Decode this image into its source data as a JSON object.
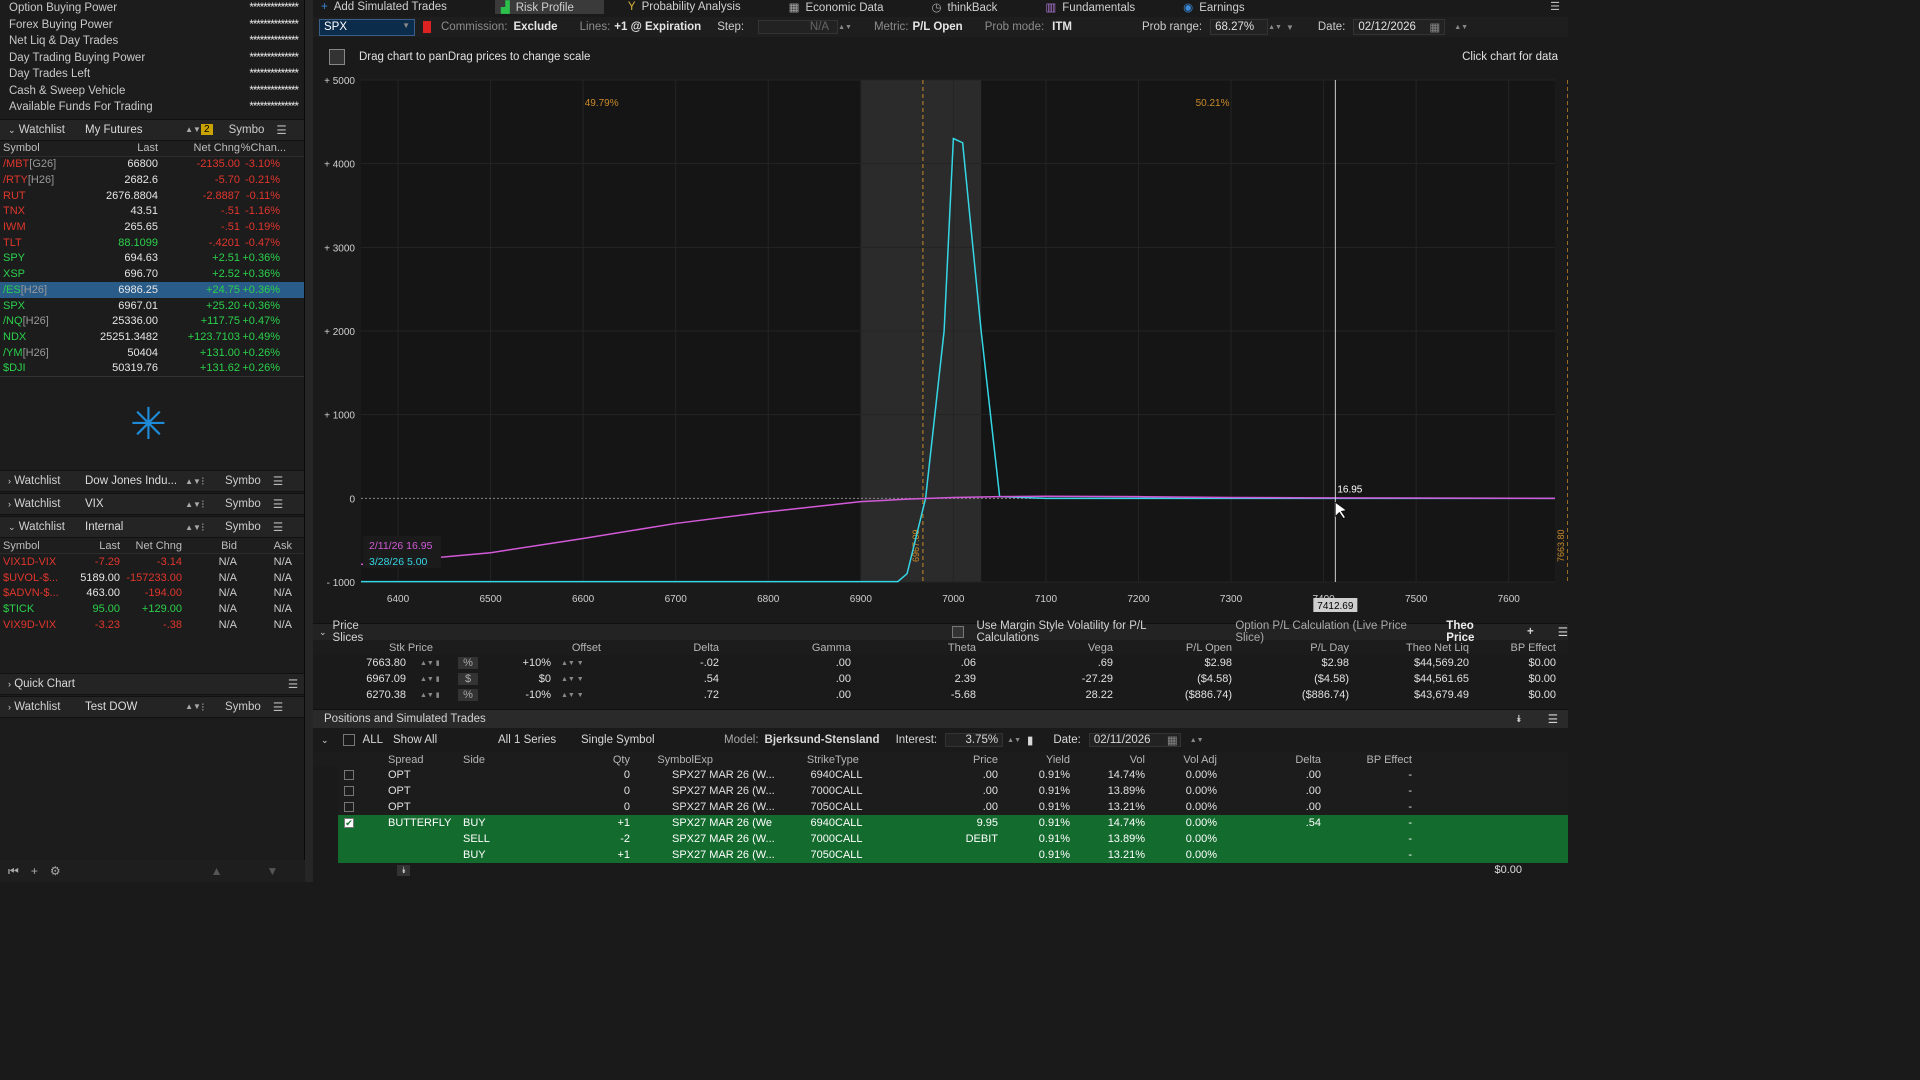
{
  "account": [
    {
      "label": "Option Buying Power",
      "value": "**************"
    },
    {
      "label": "Forex Buying Power",
      "value": "**************"
    },
    {
      "label": "Net Liq & Day Trades",
      "value": "**************"
    },
    {
      "label": "Day Trading Buying Power",
      "value": "**************"
    },
    {
      "label": "Day Trades Left",
      "value": "**************"
    },
    {
      "label": "Cash & Sweep Vehicle",
      "value": "**************"
    },
    {
      "label": "Available Funds For Trading",
      "value": "**************"
    }
  ],
  "wl1": {
    "label": "Watchlist",
    "name": "My Futures",
    "badge": "2",
    "sym": "Symbo",
    "cols": [
      "Symbol",
      "Last",
      "Net Chng",
      "%Chan..."
    ],
    "rows": [
      {
        "sym": "/MBT",
        "sub": "[G26]",
        "last": "66800",
        "net": "-2135.00",
        "pct": "-3.10%",
        "c": "red"
      },
      {
        "sym": "/RTY",
        "sub": "[H26]",
        "last": "2682.6",
        "net": "-5.70",
        "pct": "-0.21%",
        "c": "red"
      },
      {
        "sym": "RUT",
        "sub": "",
        "last": "2676.8804",
        "net": "-2.8887",
        "pct": "-0.11%",
        "c": "red"
      },
      {
        "sym": "TNX",
        "sub": "",
        "last": "43.51",
        "net": "-.51",
        "pct": "-1.16%",
        "c": "red"
      },
      {
        "sym": "IWM",
        "sub": "",
        "last": "265.65",
        "net": "-.51",
        "pct": "-0.19%",
        "c": "red"
      },
      {
        "sym": "TLT",
        "sub": "",
        "last": "88.1099",
        "net": "-.4201",
        "pct": "-0.47%",
        "c": "red"
      },
      {
        "sym": "SPY",
        "sub": "",
        "last": "694.63",
        "net": "+2.51",
        "pct": "+0.36%",
        "c": "grn"
      },
      {
        "sym": "XSP",
        "sub": "",
        "last": "696.70",
        "net": "+2.52",
        "pct": "+0.36%",
        "c": "grn"
      },
      {
        "sym": "/ES",
        "sub": "[H26]",
        "last": "6986.25",
        "net": "+24.75",
        "pct": "+0.36%",
        "c": "grn"
      },
      {
        "sym": "SPX",
        "sub": "",
        "last": "6967.01",
        "net": "+25.20",
        "pct": "+0.36%",
        "c": "grn"
      },
      {
        "sym": "/NQ",
        "sub": "[H26]",
        "last": "25336.00",
        "net": "+117.75",
        "pct": "+0.47%",
        "c": "grn"
      },
      {
        "sym": "NDX",
        "sub": "",
        "last": "25251.3482",
        "net": "+123.7103",
        "pct": "+0.49%",
        "c": "grn"
      },
      {
        "sym": "/YM",
        "sub": "[H26]",
        "last": "50404",
        "net": "+131.00",
        "pct": "+0.26%",
        "c": "grn"
      },
      {
        "sym": "$DJI",
        "sub": "",
        "last": "50319.76",
        "net": "+131.62",
        "pct": "+0.26%",
        "c": "grn"
      }
    ]
  },
  "wl2": {
    "label": "Watchlist",
    "name": "Dow Jones Indu...",
    "sym": "Symbo"
  },
  "wl3": {
    "label": "Watchlist",
    "name": "VIX",
    "sym": "Symbo"
  },
  "wl4": {
    "label": "Watchlist",
    "name": "Internal",
    "sym": "Symbo",
    "cols": [
      "Symbol",
      "Last",
      "Net Chng",
      "Bid",
      "Ask"
    ],
    "rows": [
      {
        "sym": "VIX1D-VIX",
        "last": "-7.29",
        "net": "-3.14",
        "bid": "N/A",
        "ask": "N/A"
      },
      {
        "sym": "$UVOL-$...",
        "last": "5189.00",
        "net": "-157233.00",
        "bid": "N/A",
        "ask": "N/A"
      },
      {
        "sym": "$ADVN-$...",
        "last": "463.00",
        "net": "-194.00",
        "bid": "N/A",
        "ask": "N/A"
      },
      {
        "sym": "$TICK",
        "last": "95.00",
        "net": "+129.00",
        "bid": "N/A",
        "ask": "N/A"
      },
      {
        "sym": "VIX9D-VIX",
        "last": "-3.23",
        "net": "-.38",
        "bid": "N/A",
        "ask": "N/A"
      }
    ]
  },
  "quickchart": "Quick Chart",
  "wl5": {
    "label": "Watchlist",
    "name": "Test DOW",
    "sym": "Symbo"
  },
  "tabs": [
    "Add Simulated Trades",
    "Risk Profile",
    "Probability Analysis",
    "Economic Data",
    "thinkBack",
    "Fundamentals",
    "Earnings"
  ],
  "controls": {
    "symbol": "SPX",
    "commission_lbl": "Commission:",
    "commission": "Exclude",
    "lines_lbl": "Lines:",
    "lines": "+1 @ Expiration",
    "step_lbl": "Step:",
    "step": "N/A",
    "metric_lbl": "Metric:",
    "metric": "P/L Open",
    "probmode_lbl": "Prob mode:",
    "probmode": "ITM",
    "probrange_lbl": "Prob range:",
    "probrange": "68.27%",
    "date_lbl": "Date:",
    "date": "02/12/2026"
  },
  "chart_hint": "Drag chart to panDrag prices to change scale",
  "chart_click": "Click chart for data",
  "chart_data": {
    "type": "line",
    "xlabel": "",
    "ylabel": "",
    "xlim": [
      6360,
      7650
    ],
    "ylim": [
      -1000,
      5000
    ],
    "xticks": [
      "6400",
      "6500",
      "6600",
      "6700",
      "6800",
      "6900",
      "7000",
      "7100",
      "7200",
      "7300",
      "7400",
      "7500",
      "7600"
    ],
    "yticks": [
      "+ 5000",
      "+ 4000",
      "+ 3000",
      "+ 2000",
      "+ 1000",
      "0",
      "- 1000"
    ],
    "series": [
      {
        "name": "3/28/26 5.00",
        "color": "#35d7e6",
        "x": [
          6360,
          6900,
          6940,
          6950,
          6970,
          6990,
          7000,
          7010,
          7030,
          7050,
          7100,
          7200,
          7650
        ],
        "y": [
          -995,
          -995,
          -995,
          -900,
          0,
          2000,
          4300,
          4250,
          2000,
          20,
          0,
          0,
          0
        ]
      },
      {
        "name": "2/11/26 16.95",
        "color": "#d25ad8",
        "x": [
          6360,
          6500,
          6600,
          6700,
          6800,
          6900,
          6950,
          7000,
          7050,
          7100,
          7200,
          7300,
          7400,
          7650
        ],
        "y": [
          -790,
          -650,
          -480,
          -300,
          -160,
          -40,
          -10,
          10,
          20,
          25,
          20,
          10,
          5,
          0
        ]
      }
    ],
    "pct_left": "49.79%",
    "pct_right": "50.21%",
    "vline_left": "6967.09",
    "vline_right": "7663.80",
    "cursor_x": "7412.69",
    "cursor_val": "16.95"
  },
  "price_slices": {
    "title": "Price Slices",
    "margin_lbl": "Use Margin Style Volatility for P/L Calculations",
    "calc_lbl": "Option P/L Calculation (Live Price Slice)",
    "calc": "Theo Price",
    "cols": [
      "Stk Price",
      "Offset",
      "Delta",
      "Gamma",
      "Theta",
      "Vega",
      "P/L Open",
      "P/L Day",
      "Theo Net Liq",
      "BP Effect"
    ],
    "rows": [
      {
        "stk": "7663.80",
        "unit": "%",
        "off": "+10%",
        "delta": "-.02",
        "gamma": ".00",
        "theta": ".06",
        "vega": ".69",
        "plopen": "$2.98",
        "plday": "$2.98",
        "liq": "$44,569.20",
        "bp": "$0.00"
      },
      {
        "stk": "6967.09",
        "unit": "$",
        "off": "$0",
        "delta": ".54",
        "gamma": ".00",
        "theta": "2.39",
        "vega": "-27.29",
        "plopen": "($4.58)",
        "plday": "($4.58)",
        "liq": "$44,561.65",
        "bp": "$0.00"
      },
      {
        "stk": "6270.38",
        "unit": "%",
        "off": "-10%",
        "delta": ".72",
        "gamma": ".00",
        "theta": "-5.68",
        "vega": "28.22",
        "plopen": "($886.74)",
        "plday": "($886.74)",
        "liq": "$43,679.49",
        "bp": "$0.00"
      }
    ]
  },
  "positions": {
    "title": "Positions and Simulated Trades",
    "all": "ALL",
    "showall": "Show All",
    "series": "All 1 Series",
    "single": "Single Symbol",
    "model_lbl": "Model:",
    "model": "Bjerksund-Stensland",
    "interest_lbl": "Interest:",
    "interest": "3.75%",
    "date_lbl": "Date:",
    "date": "02/11/2026",
    "cols": [
      "Spread",
      "Side",
      "Qty",
      "Symbol",
      "Exp",
      "Strike",
      "Type",
      "Price",
      "Yield",
      "Vol",
      "Vol Adj",
      "Delta",
      "BP Effect"
    ],
    "rows": [
      {
        "spread": "OPT",
        "side": "",
        "qty": "0",
        "sym": "SPX",
        "exp": "27 MAR 26 (W...",
        "strike": "6940",
        "type": "CALL",
        "price": ".00",
        "yield": "0.91%",
        "vol": "14.74%",
        "adj": "0.00%",
        "delta": ".00",
        "bp": "-",
        "g": false
      },
      {
        "spread": "OPT",
        "side": "",
        "qty": "0",
        "sym": "SPX",
        "exp": "27 MAR 26 (W...",
        "strike": "7000",
        "type": "CALL",
        "price": ".00",
        "yield": "0.91%",
        "vol": "13.89%",
        "adj": "0.00%",
        "delta": ".00",
        "bp": "-",
        "g": false
      },
      {
        "spread": "OPT",
        "side": "",
        "qty": "0",
        "sym": "SPX",
        "exp": "27 MAR 26 (W...",
        "strike": "7050",
        "type": "CALL",
        "price": ".00",
        "yield": "0.91%",
        "vol": "13.21%",
        "adj": "0.00%",
        "delta": ".00",
        "bp": "-",
        "g": false
      },
      {
        "spread": "BUTTERFLY",
        "side": "BUY",
        "qty": "+1",
        "sym": "SPX",
        "exp": "27 MAR 26 (We",
        "strike": "6940",
        "type": "CALL",
        "price": "9.95",
        "yield": "0.91%",
        "vol": "14.74%",
        "adj": "0.00%",
        "delta": ".54",
        "bp": "-",
        "g": true
      },
      {
        "spread": "",
        "side": "SELL",
        "qty": "-2",
        "sym": "SPX",
        "exp": "27 MAR 26 (W...",
        "strike": "7000",
        "type": "CALL",
        "price": "DEBIT",
        "yield": "0.91%",
        "vol": "13.89%",
        "adj": "0.00%",
        "delta": "",
        "bp": "-",
        "g": true
      },
      {
        "spread": "",
        "side": "BUY",
        "qty": "+1",
        "sym": "SPX",
        "exp": "27 MAR 26 (W...",
        "strike": "7050",
        "type": "CALL",
        "price": "",
        "yield": "0.91%",
        "vol": "13.21%",
        "adj": "0.00%",
        "delta": "",
        "bp": "-",
        "g": true
      }
    ],
    "total": "$0.00"
  }
}
